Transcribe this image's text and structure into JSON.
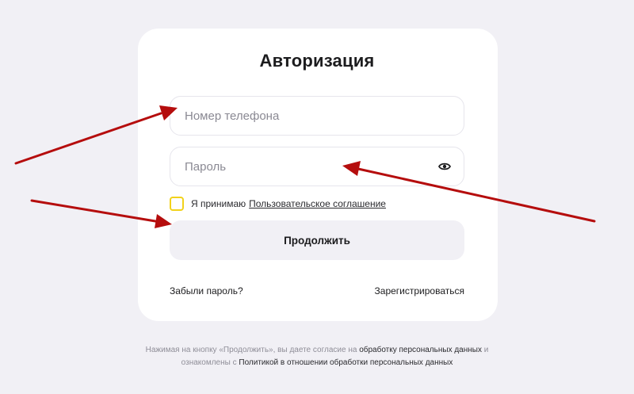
{
  "form": {
    "title": "Авторизация",
    "phone_placeholder": "Номер телефона",
    "password_placeholder": "Пароль",
    "agree_text": "Я принимаю",
    "agree_link": "Пользовательское соглашение",
    "continue_label": "Продолжить",
    "forgot_label": "Забыли пароль?",
    "register_label": "Зарегистрироваться"
  },
  "footer": {
    "part1": "Нажимая на кнопку «Продолжить», вы даете согласие на",
    "link1": "обработку персональных данных",
    "part2": "и",
    "part3": "ознакомлены с",
    "link2": "Политикой в отношении обработки персональных данных"
  },
  "colors": {
    "background": "#f1f0f5",
    "card": "#ffffff",
    "checkbox_border": "#f2d21b",
    "annotation_arrow": "#b50d0d"
  },
  "icons": {
    "password_toggle": "eye-icon"
  }
}
